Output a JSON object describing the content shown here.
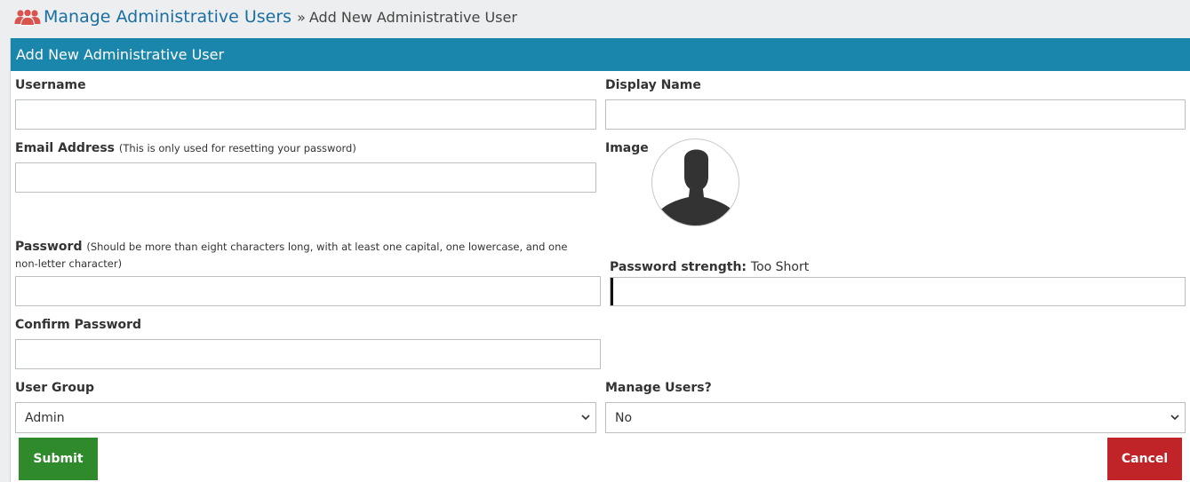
{
  "breadcrumb": {
    "parent": "Manage Administrative Users",
    "separator": "»",
    "current": "Add New Administrative User"
  },
  "panel": {
    "title": "Add New Administrative User"
  },
  "form": {
    "username": {
      "label": "Username",
      "value": ""
    },
    "display_name": {
      "label": "Display Name",
      "value": ""
    },
    "email": {
      "label": "Email Address",
      "hint": "(This is only used for resetting your password)",
      "value": ""
    },
    "image": {
      "label": "Image"
    },
    "password": {
      "label": "Password",
      "hint": "(Should be more than eight characters long, with at least one capital, one lowercase, and one non-letter character)",
      "value": ""
    },
    "password_strength": {
      "label": "Password strength:",
      "value": "Too Short"
    },
    "confirm_password": {
      "label": "Confirm Password",
      "value": ""
    },
    "user_group": {
      "label": "User Group",
      "selected": "Admin"
    },
    "manage_users": {
      "label": "Manage Users?",
      "selected": "No"
    }
  },
  "actions": {
    "submit_label": "Submit",
    "cancel_label": "Cancel"
  },
  "colors": {
    "header": "#1a86ac",
    "link": "#1a6fa0",
    "submit": "#2e8a2a",
    "cancel": "#c02328",
    "icon": "#d9534f"
  },
  "icons": {
    "breadcrumb": "users-icon",
    "avatar": "person-silhouette-icon",
    "select": "chevron-down-icon"
  }
}
